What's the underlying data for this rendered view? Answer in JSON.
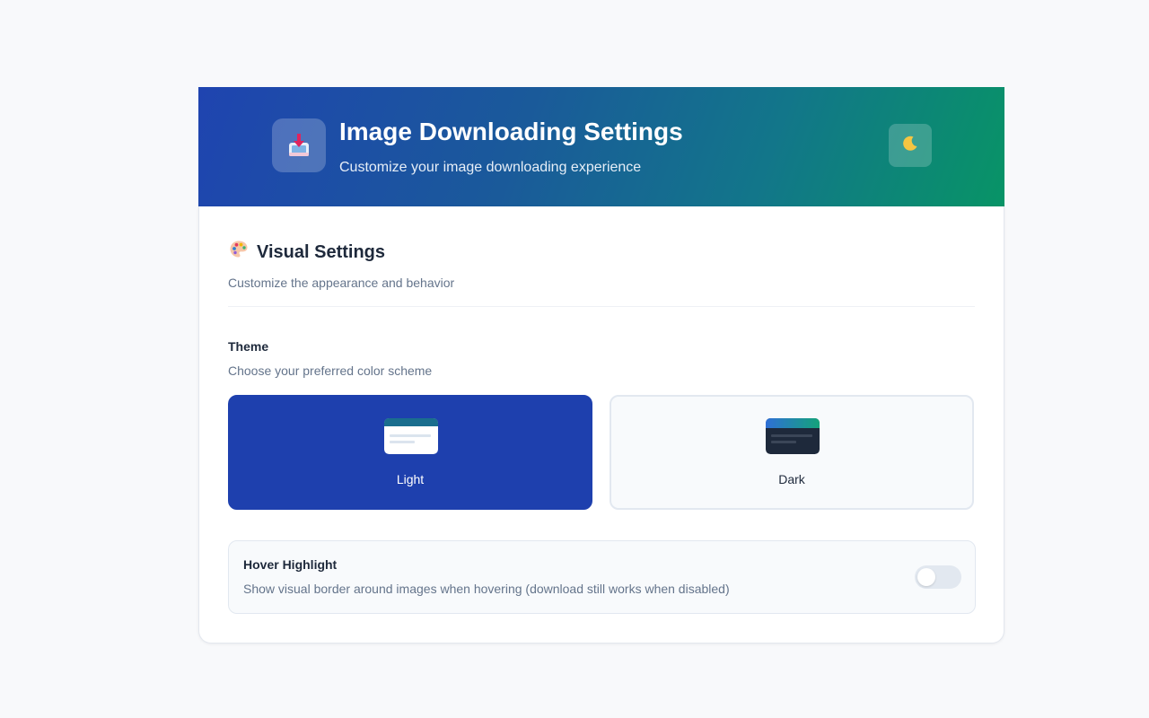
{
  "header": {
    "title": "Image Downloading Settings",
    "subtitle": "Customize your image downloading experience",
    "app_icon": "download-tray-icon",
    "theme_toggle_icon": "crescent-moon-icon",
    "gradient_start": "#1f44b0",
    "gradient_end": "#089466"
  },
  "visual_section": {
    "icon": "palette-icon",
    "title": "Visual Settings",
    "subtitle": "Customize the appearance and behavior"
  },
  "theme": {
    "label": "Theme",
    "description": "Choose your preferred color scheme",
    "selected": "Light",
    "options": [
      {
        "label": "Light",
        "selected": true
      },
      {
        "label": "Dark",
        "selected": false
      }
    ],
    "accent": "#1e40ae"
  },
  "hover_highlight": {
    "title": "Hover Highlight",
    "description": "Show visual border around images when hovering (download still works when disabled)",
    "enabled": false
  }
}
